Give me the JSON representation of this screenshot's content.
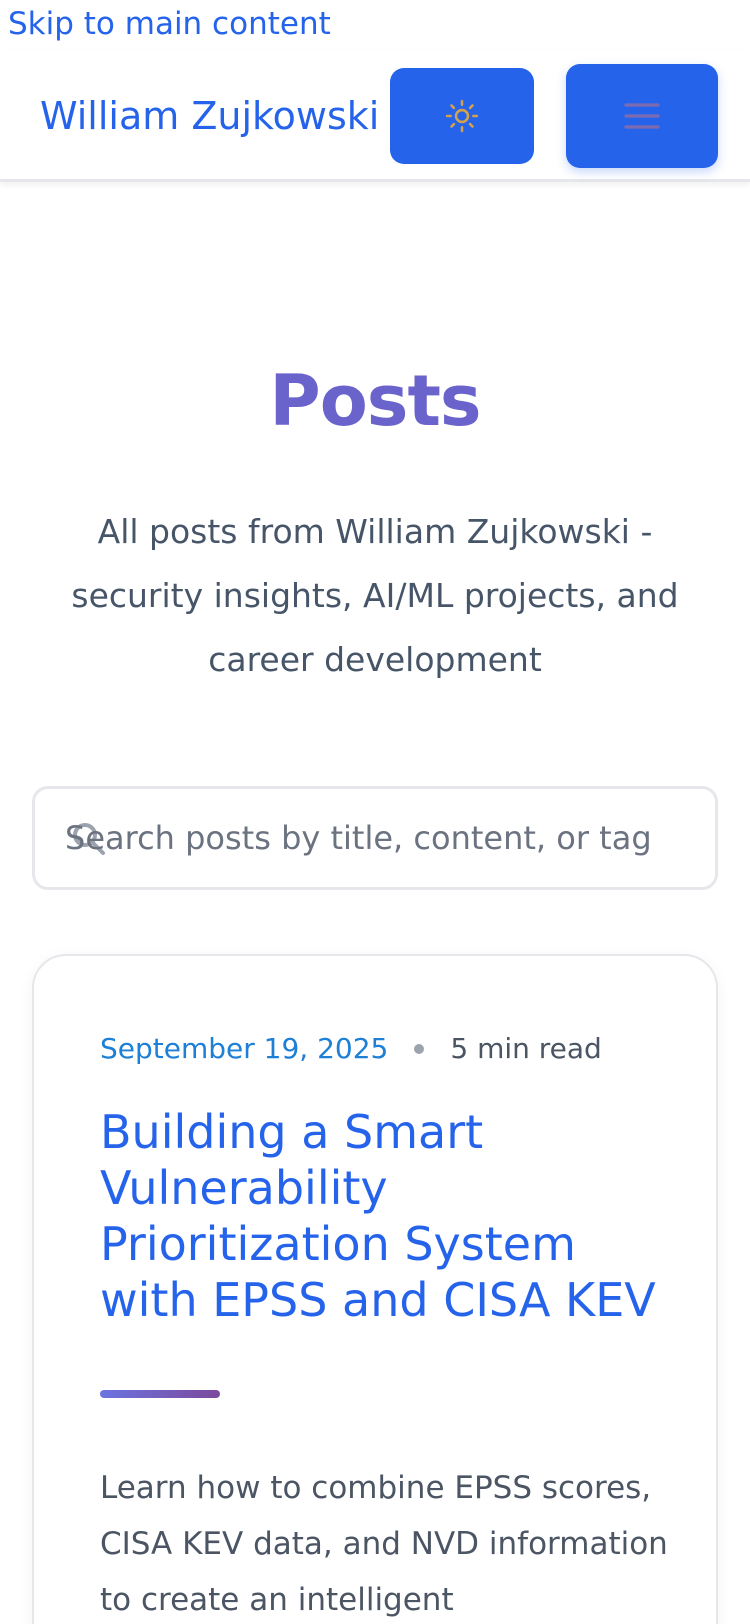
{
  "skip_link": "Skip to main content",
  "header": {
    "brand": "William Zujkowski",
    "theme_toggle_icon": "sun-icon",
    "menu_icon": "hamburger-menu-icon",
    "accent_color": "#2563eb"
  },
  "main": {
    "title": "Posts",
    "subtitle": "All posts from William Zujkowski - security insights, AI/ML projects, and career development",
    "search": {
      "placeholder": "Search posts by title, content, or tag",
      "value": ""
    },
    "posts": [
      {
        "date": "September 19, 2025",
        "read_time": "5 min read",
        "title": "Building a Smart Vulnerability Prioritization System with EPSS and CISA KEV",
        "excerpt": "Learn how to combine EPSS scores, CISA KEV data, and NVD information to create an intelligent"
      }
    ]
  }
}
